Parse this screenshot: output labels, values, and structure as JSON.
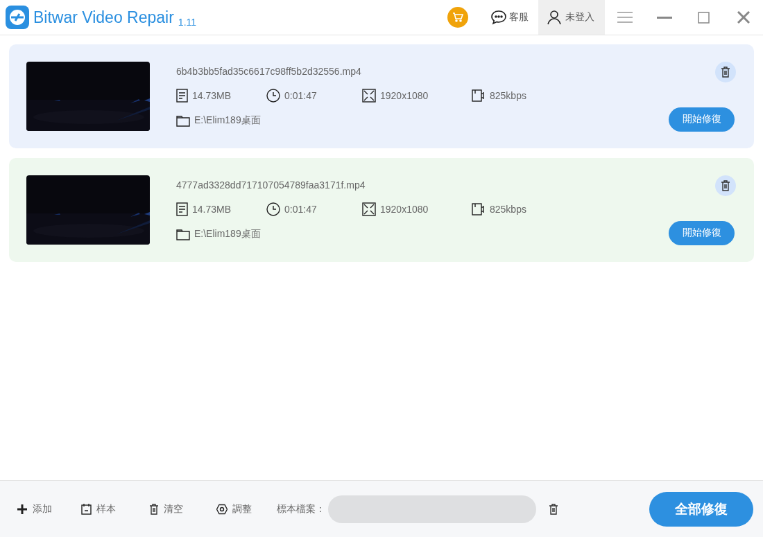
{
  "window": {
    "title": "Bitwar Video Repair",
    "version": "1.11",
    "support": "客服",
    "account": "未登入"
  },
  "videos": [
    {
      "filename": "6b4b3bb5fad35c6617c98ff5b2d32556.mp4",
      "size": "14.73MB",
      "duration": "0:01:47",
      "resolution": "1920x1080",
      "bitrate": "825kbps",
      "path": "E:\\Elim189桌面",
      "color": "#ebf1fc",
      "repair_button": "開始修復"
    },
    {
      "filename": "4777ad3328dd717107054789faa3171f.mp4",
      "size": "14.73MB",
      "duration": "0:01:47",
      "resolution": "1920x1080",
      "bitrate": "825kbps",
      "path": "E:\\Elim189桌面",
      "color": "#eef8ee",
      "repair_button": "開始修復"
    }
  ],
  "toolbar": {
    "items": [
      {
        "kind": "add",
        "label": "添加"
      },
      {
        "kind": "sample",
        "label": "样本"
      },
      {
        "kind": "clear",
        "label": "清空"
      },
      {
        "kind": "adjust",
        "label": "調整"
      }
    ],
    "sample_file_label": "標本檔案：",
    "repair_all_button": "全部修復"
  }
}
